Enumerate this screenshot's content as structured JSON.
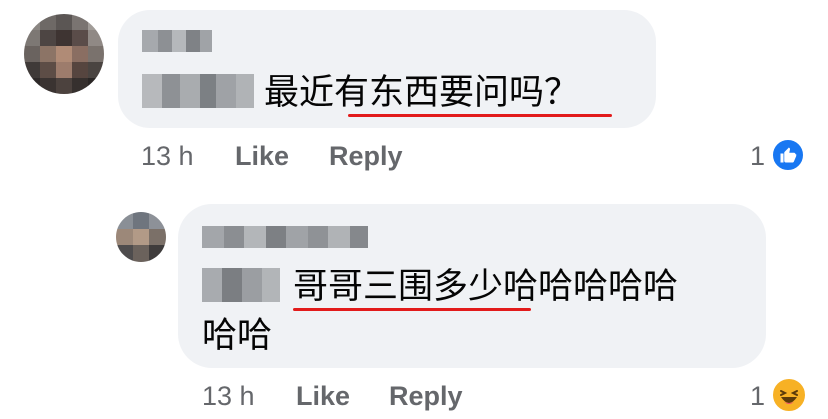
{
  "comments": [
    {
      "text": "最近有东西要问吗？",
      "time": "13 h",
      "like_label": "Like",
      "reply_label": "Reply",
      "reaction_count": "1",
      "reaction_icon": "like-icon"
    },
    {
      "text_line1": "哥哥三围多少哈哈哈哈哈",
      "text_line2": "哈哈",
      "time": "13 h",
      "like_label": "Like",
      "reply_label": "Reply",
      "reaction_count": "1",
      "reaction_icon": "haha-icon"
    }
  ],
  "colors": {
    "bubble": "#f0f2f5",
    "meta_text": "#65676b",
    "underline": "#e21b1b",
    "like_blue": "#1877f2",
    "haha_yellow": "#f7b125"
  }
}
